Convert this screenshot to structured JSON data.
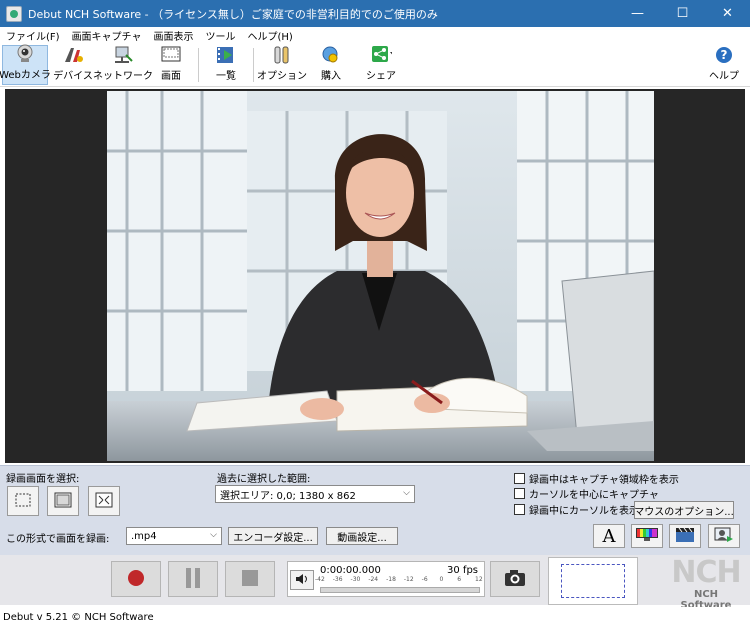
{
  "window": {
    "title": "Debut NCH Software - （ライセンス無し）ご家庭での非営利目的でのご使用のみ",
    "minimize": "—",
    "maximize": "☐",
    "close": "✕"
  },
  "menu": [
    "ファイル(F)",
    "画面キャプチャ",
    "画面表示",
    "ツール",
    "ヘルプ(H)"
  ],
  "toolbar": {
    "webcam": "Webカメラ",
    "devices": "デバイス",
    "network": "ネットワーク",
    "screen": "画面",
    "list": "一覧",
    "options": "オプション",
    "buy": "購入",
    "share": "シェア",
    "help": "ヘルプ"
  },
  "capture": {
    "select_label": "録画画面を選択:",
    "recent_label": "過去に選択した範囲:",
    "recent_value": "選択エリア: 0,0; 1380 x 862",
    "show_border": "録画中はキャプチャ領域枠を表示",
    "center_cursor": "カーソルを中心にキャプチャ",
    "show_cursor": "録画中にカーソルを表示",
    "mouse_options": "マウスのオプション..."
  },
  "format": {
    "label": "この形式で画面を録画:",
    "value": ".mp4",
    "encoder_settings": "エンコーダ設定...",
    "video_settings": "動画設定...",
    "text_icon": "A"
  },
  "recording": {
    "time": "0:00:00.000",
    "fps": "30 fps",
    "meter_ticks": [
      "-42",
      "-36",
      "-30",
      "-24",
      "-18",
      "-12",
      "-6",
      "0",
      "6",
      "12"
    ]
  },
  "logo": {
    "mark": "NCH",
    "name": "NCH Software"
  },
  "status": "Debut v 5.21 © NCH Software"
}
